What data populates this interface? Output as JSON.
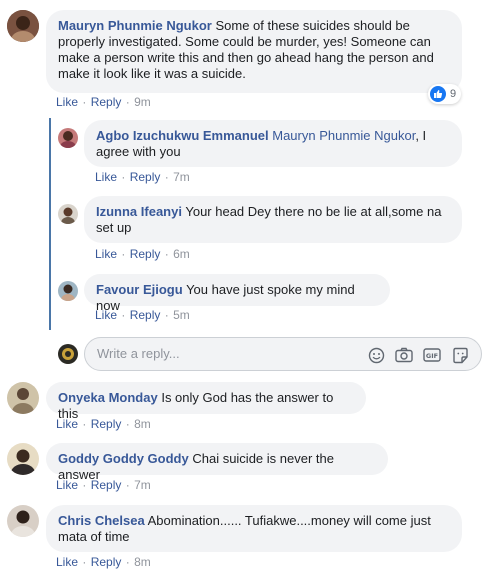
{
  "comments": [
    {
      "name": "Mauryn Phunmie Ngukor",
      "text": "Some of these suicides should be properly investigated. Some could be murder, yes! Someone can make a person write this and then go ahead hang the person and make it look like it was a suicide.",
      "like": "Like",
      "reply": "Reply",
      "time": "9m",
      "reactions": "9"
    },
    {
      "name": "Agbo Izuchukwu Emmanuel",
      "mention": "Mauryn Phunmie Ngukor",
      "text": ", I agree with you",
      "like": "Like",
      "reply": "Reply",
      "time": "7m"
    },
    {
      "name": "Izunna Ifeanyi",
      "text": "Your head Dey there no be lie at all,some na set up",
      "like": "Like",
      "reply": "Reply",
      "time": "6m"
    },
    {
      "name": "Favour Ejiogu",
      "text": "You have just spoke my mind now",
      "like": "Like",
      "reply": "Reply",
      "time": "5m"
    },
    {
      "name": "Onyeka Monday",
      "text": "Is only God has the answer to this",
      "like": "Like",
      "reply": "Reply",
      "time": "8m"
    },
    {
      "name": "Goddy Goddy Goddy",
      "text": "Chai suicide is never the answer",
      "like": "Like",
      "reply": "Reply",
      "time": "7m"
    },
    {
      "name": "Chris Chelsea",
      "text": "Abomination...... Tufiakwe....money will come just mata of time",
      "like": "Like",
      "reply": "Reply",
      "time": "8m"
    }
  ],
  "reply_box": {
    "placeholder": "Write a reply...",
    "icons": [
      "emoji-icon",
      "camera-icon",
      "gif-icon",
      "sticker-icon"
    ]
  },
  "colors": {
    "link": "#385898",
    "bubble": "#f2f3f5",
    "meta": "#90949c",
    "like_blue": "#1877f2",
    "thread_line": "#4a76a8"
  }
}
